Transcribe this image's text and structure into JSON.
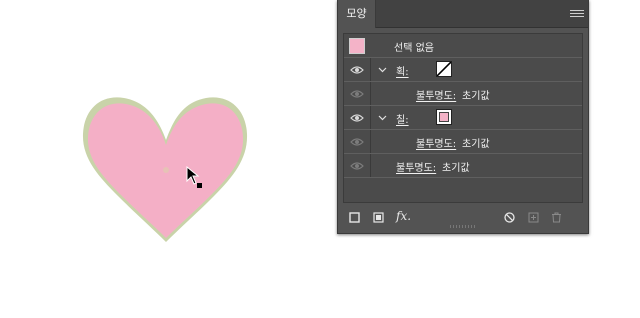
{
  "panel": {
    "tab_label": "모양",
    "no_selection": "선택 없음",
    "stroke_label": "획:",
    "fill_label": "칠:",
    "opacity_label": "불투명도:",
    "opacity_value": "초기값",
    "fx_label": "fx."
  },
  "colors": {
    "heart_fill": "#f4afc6",
    "heart_outline": "#c9d3a9",
    "fill_swatch": "#f4b3c8",
    "panel_bg": "#535353"
  }
}
